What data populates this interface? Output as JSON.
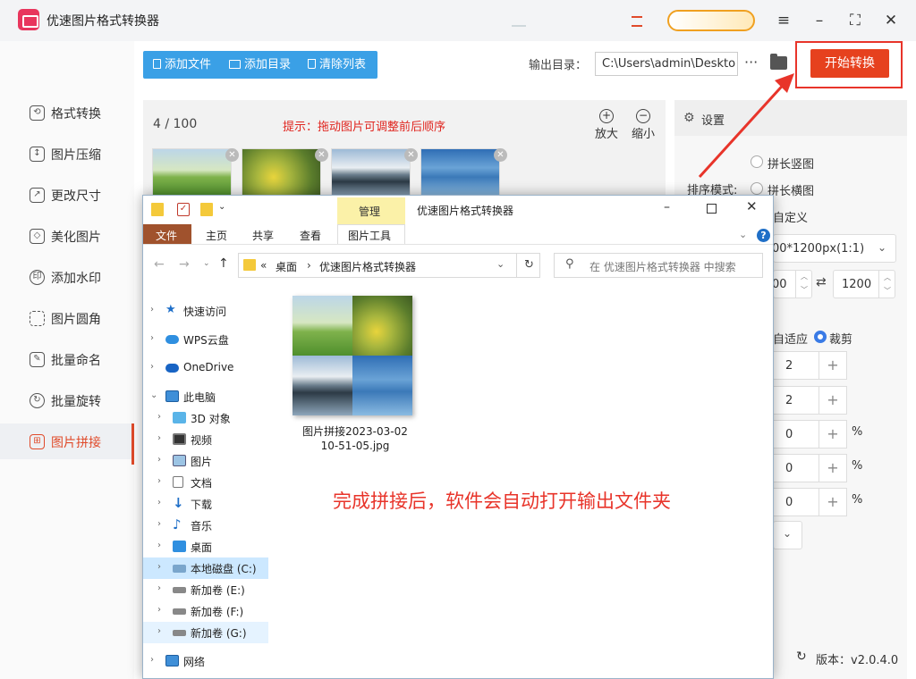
{
  "app": {
    "title": "优速图片格式转换器",
    "window_controls": {
      "menu": "≡",
      "minimize": "–",
      "maximize": "⛶",
      "close": "✕"
    }
  },
  "sidebar": {
    "items": [
      {
        "label": "格式转换",
        "icon": "format-convert-icon",
        "active": false
      },
      {
        "label": "图片压缩",
        "icon": "compress-icon",
        "active": false
      },
      {
        "label": "更改尺寸",
        "icon": "resize-icon",
        "active": false
      },
      {
        "label": "美化图片",
        "icon": "beautify-icon",
        "active": false
      },
      {
        "label": "添加水印",
        "icon": "watermark-icon",
        "active": false
      },
      {
        "label": "图片圆角",
        "icon": "round-corner-icon",
        "active": false
      },
      {
        "label": "批量命名",
        "icon": "rename-icon",
        "active": false
      },
      {
        "label": "批量旋转",
        "icon": "rotate-icon",
        "active": false
      },
      {
        "label": "图片拼接",
        "icon": "stitch-icon",
        "active": true
      }
    ]
  },
  "toolbar": {
    "add_file": "添加文件",
    "add_folder": "添加目录",
    "clear_list": "清除列表",
    "output_label": "输出目录：",
    "output_path": "C:\\Users\\admin\\Deskto",
    "more": "···",
    "start": "开始转换"
  },
  "content": {
    "count": "4 / 100",
    "hint": "提示：拖动图片可调整前后顺序",
    "zoom_in": "放大",
    "zoom_out": "缩小",
    "thumbnails": [
      "thumb-meadow",
      "thumb-rapeseed",
      "thumb-mountain-lake",
      "thumb-blue-mountains"
    ]
  },
  "settings": {
    "title": "设置",
    "sort_label": "排序模式:",
    "opt_vertical": "拼长竖图",
    "opt_horizontal": "拼长横图",
    "opt_custom": "自定义",
    "size_select": "00*1200px(1:1)",
    "width_value": "00",
    "height_value": "1200",
    "fit_label": "自适应",
    "crop_label": "裁剪",
    "rows": [
      "2",
      "2",
      "0",
      "0",
      "0"
    ],
    "percent": "%",
    "version": "版本：v2.0.4.0"
  },
  "explorer": {
    "ribbon_manage": "管理",
    "window_title": "优速图片格式转换器",
    "tabs": [
      "文件",
      "主页",
      "共享",
      "查看",
      "图片工具"
    ],
    "help": "?",
    "breadcrumb": [
      "«",
      "桌面",
      "›",
      "优速图片格式转换器"
    ],
    "search_placeholder": "在 优速图片格式转换器 中搜索",
    "nav": [
      {
        "label": "快速访问",
        "arrow": "›",
        "icon": "star",
        "selected": false,
        "indent": 0
      },
      {
        "label": "WPS云盘",
        "arrow": "›",
        "icon": "cloud-wps",
        "selected": false,
        "indent": 0
      },
      {
        "label": "OneDrive",
        "arrow": "›",
        "icon": "cloud-onedrive",
        "selected": false,
        "indent": 0
      },
      {
        "label": "此电脑",
        "arrow": "⌄",
        "icon": "computer",
        "selected": false,
        "indent": 0
      },
      {
        "label": "3D 对象",
        "arrow": "›",
        "icon": "cube",
        "selected": false,
        "indent": 1
      },
      {
        "label": "视频",
        "arrow": "›",
        "icon": "video",
        "selected": false,
        "indent": 1
      },
      {
        "label": "图片",
        "arrow": "›",
        "icon": "pictures",
        "selected": false,
        "indent": 1
      },
      {
        "label": "文档",
        "arrow": "›",
        "icon": "documents",
        "selected": false,
        "indent": 1
      },
      {
        "label": "下载",
        "arrow": "›",
        "icon": "download",
        "selected": false,
        "indent": 1
      },
      {
        "label": "音乐",
        "arrow": "›",
        "icon": "music",
        "selected": false,
        "indent": 1
      },
      {
        "label": "桌面",
        "arrow": "›",
        "icon": "desktop",
        "selected": false,
        "indent": 1
      },
      {
        "label": "本地磁盘 (C:)",
        "arrow": "›",
        "icon": "drive-c",
        "selected": true,
        "indent": 1
      },
      {
        "label": "新加卷 (E:)",
        "arrow": "›",
        "icon": "drive",
        "selected": false,
        "indent": 1
      },
      {
        "label": "新加卷 (F:)",
        "arrow": "›",
        "icon": "drive",
        "selected": false,
        "indent": 1
      },
      {
        "label": "新加卷 (G:)",
        "arrow": "›",
        "icon": "drive",
        "selected": true,
        "indent": 1
      },
      {
        "label": "网络",
        "arrow": "›",
        "icon": "network",
        "selected": false,
        "indent": 0
      }
    ],
    "file_name_line1": "图片拼接2023-03-02",
    "file_name_line2": "10-51-05.jpg",
    "annotation": "完成拼接后，软件会自动打开输出文件夹"
  },
  "colors": {
    "accent": "#e6411e",
    "toolbar": "#3aa0e6",
    "hint": "#e0251f",
    "annotation": "#e8342a",
    "ribbon_manage": "#fbf1a8",
    "file_tab": "#a0522d"
  }
}
